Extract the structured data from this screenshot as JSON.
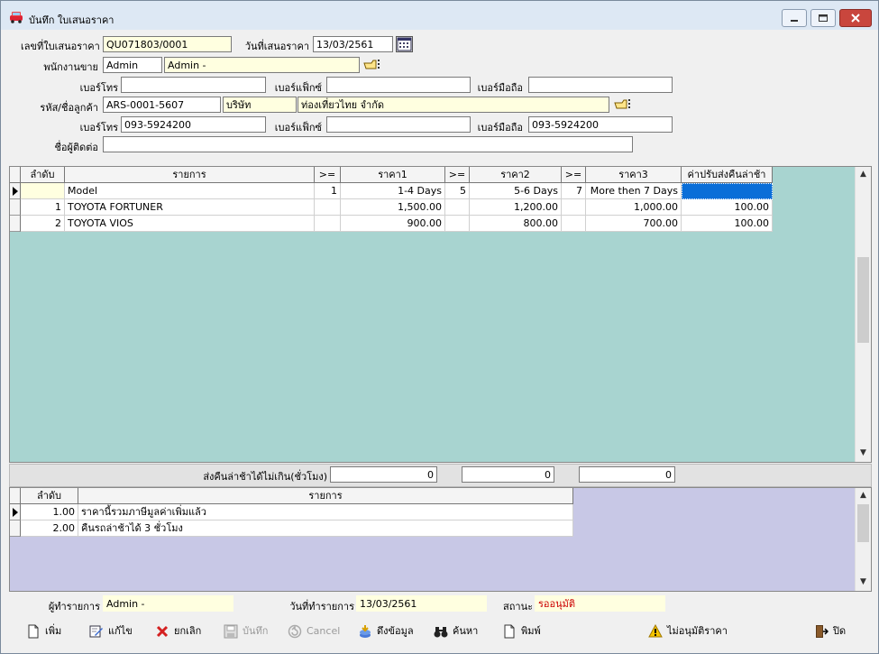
{
  "window": {
    "title": "บันทึก ใบเสนอราคา"
  },
  "form": {
    "quote_no_label": "เลขที่ใบเสนอราคา",
    "quote_no": "QU071803/0001",
    "quote_date_label": "วันที่เสนอราคา",
    "quote_date": "13/03/2561",
    "salesperson_label": "พนักงานขาย",
    "salesperson_code": "Admin",
    "salesperson_name": "Admin -",
    "phone_label": "เบอร์โทร",
    "phone": "",
    "fax_label": "เบอร์แฟ็กซ์",
    "fax": "",
    "mobile_label": "เบอร์มือถือ",
    "mobile": "",
    "customer_label": "รหัส/ชื่อลูกค้า",
    "customer_code": "ARS-0001-5607",
    "customer_type": "บริษัท",
    "customer_name": "ท่องเที่ยวไทย จำกัด",
    "cust_phone_label": "เบอร์โทร",
    "cust_phone": "093-5924200",
    "cust_fax_label": "เบอร์แฟ็กซ์",
    "cust_fax": "",
    "cust_mobile_label": "เบอร์มือถือ",
    "cust_mobile": "093-5924200",
    "contact_label": "ชื่อผู้ติดต่อ",
    "contact": ""
  },
  "grid1": {
    "headers": [
      "ลำดับ",
      "รายการ",
      ">=",
      "ราคา1",
      ">=",
      "ราคา2",
      ">=",
      "ราคา3",
      "ค่าปรับส่งคืนล่าช้า"
    ],
    "rows": [
      [
        "",
        "Model",
        "1",
        "1-4 Days",
        "5",
        "5-6 Days",
        "7",
        "More then 7 Days",
        ""
      ],
      [
        "1",
        "TOYOTA FORTUNER",
        "",
        "1,500.00",
        "",
        "1,200.00",
        "",
        "1,000.00",
        "100.00"
      ],
      [
        "2",
        "TOYOTA VIOS",
        "",
        "900.00",
        "",
        "800.00",
        "",
        "700.00",
        "100.00"
      ]
    ]
  },
  "late_return": {
    "label": "ส่งคืนล่าช้าได้ไม่เกิน(ชั่วโมง)",
    "v1": "0",
    "v2": "0",
    "v3": "0"
  },
  "grid2": {
    "headers": [
      "ลำดับ",
      "รายการ"
    ],
    "rows": [
      [
        "1.00",
        "ราคานี้รวมภาษีมูลค่าเพิ่มแล้ว"
      ],
      [
        "2.00",
        "คืนรถล่าช้าได้ 3 ชั่วโมง"
      ]
    ]
  },
  "footer": {
    "maker_label": "ผู้ทำรายการ",
    "maker": "Admin -",
    "made_date_label": "วันที่ทำรายการ",
    "made_date": "13/03/2561",
    "status_label": "สถานะ",
    "status": "รออนุมัติ"
  },
  "toolbar": {
    "add": "เพิ่ม",
    "edit": "แก้ไข",
    "cancel_doc": "ยกเลิก",
    "save": "บันทึก",
    "cancel": "Cancel",
    "pull_data": "ดึงข้อมูล",
    "search": "ค้นหา",
    "print": "พิมพ์",
    "reject": "ไม่อนุมัติราคา",
    "close": "ปิด"
  },
  "colors": {
    "grid_bg": "#a8d4d0",
    "grid2_bg": "#c8c8e6",
    "yellow_field": "#ffffe0",
    "status_red": "#cc0000",
    "selected_cell": "#0a6ed8"
  }
}
